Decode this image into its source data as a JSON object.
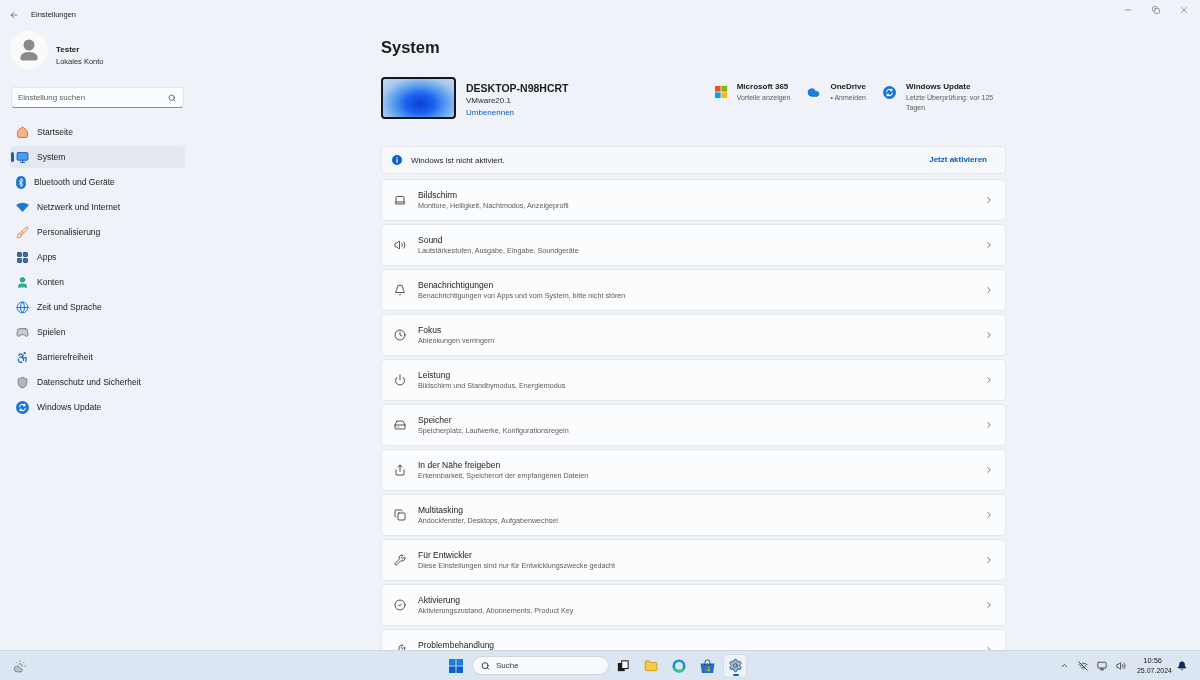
{
  "window": {
    "title": "Einstellungen"
  },
  "user": {
    "name": "Tester",
    "account": "Lokales Konto"
  },
  "search": {
    "placeholder": "Einstellung suchen"
  },
  "sidebar": {
    "items": [
      {
        "label": "Startseite",
        "selected": false
      },
      {
        "label": "System",
        "selected": true
      },
      {
        "label": "Bluetooth und Geräte",
        "selected": false
      },
      {
        "label": "Netzwerk und Internet",
        "selected": false
      },
      {
        "label": "Personalisierung",
        "selected": false
      },
      {
        "label": "Apps",
        "selected": false
      },
      {
        "label": "Konten",
        "selected": false
      },
      {
        "label": "Zeit und Sprache",
        "selected": false
      },
      {
        "label": "Spielen",
        "selected": false
      },
      {
        "label": "Barrierefreiheit",
        "selected": false
      },
      {
        "label": "Datenschutz und Sicherheit",
        "selected": false
      },
      {
        "label": "Windows Update",
        "selected": false
      }
    ]
  },
  "page": {
    "title": "System"
  },
  "device": {
    "name": "DESKTOP-N98HCRT",
    "model": "VMware20.1",
    "rename_link": "Umbenennen"
  },
  "services": [
    {
      "title": "Microsoft 365",
      "subtitle": "Vorteile anzeigen"
    },
    {
      "title": "OneDrive",
      "subtitle": "• Anmelden"
    },
    {
      "title": "Windows Update",
      "subtitle": "Letzte Überprüfung: vor 125 Tagen"
    }
  ],
  "notice": {
    "text": "Windows ist nicht aktiviert.",
    "action": "Jetzt aktivieren"
  },
  "settings": [
    {
      "title": "Bildschirm",
      "subtitle": "Monitore, Helligkeit, Nachtmodus, Anzeigeprofil"
    },
    {
      "title": "Sound",
      "subtitle": "Lautstärkestufen, Ausgabe, Eingabe, Soundgeräte"
    },
    {
      "title": "Benachrichtigungen",
      "subtitle": "Benachrichtigungen von Apps und vom System, bitte nicht stören"
    },
    {
      "title": "Fokus",
      "subtitle": "Ablenkungen verringern"
    },
    {
      "title": "Leistung",
      "subtitle": "Bildschirm und Standbymodus, Energiemodus"
    },
    {
      "title": "Speicher",
      "subtitle": "Speicherplatz, Laufwerke, Konfigurationsregeln"
    },
    {
      "title": "In der Nähe freigeben",
      "subtitle": "Erkennbarkeit, Speicherort der empfangenen Dateien"
    },
    {
      "title": "Multitasking",
      "subtitle": "Andockfenster, Desktops, Aufgabenwechsel"
    },
    {
      "title": "Für Entwickler",
      "subtitle": "Diese Einstellungen sind nur für Entwicklungszwecke gedacht"
    },
    {
      "title": "Aktivierung",
      "subtitle": "Aktivierungszustand, Abonnements, Product Key"
    },
    {
      "title": "Problembehandlung"
    }
  ],
  "taskbar": {
    "search": {
      "placeholder": "Suche"
    },
    "apps": [
      {
        "selected": false
      },
      {
        "selected": false
      },
      {
        "selected": false
      },
      {
        "selected": false
      },
      {
        "selected": true
      }
    ],
    "time": "10:56",
    "date": "25.07.2024"
  }
}
